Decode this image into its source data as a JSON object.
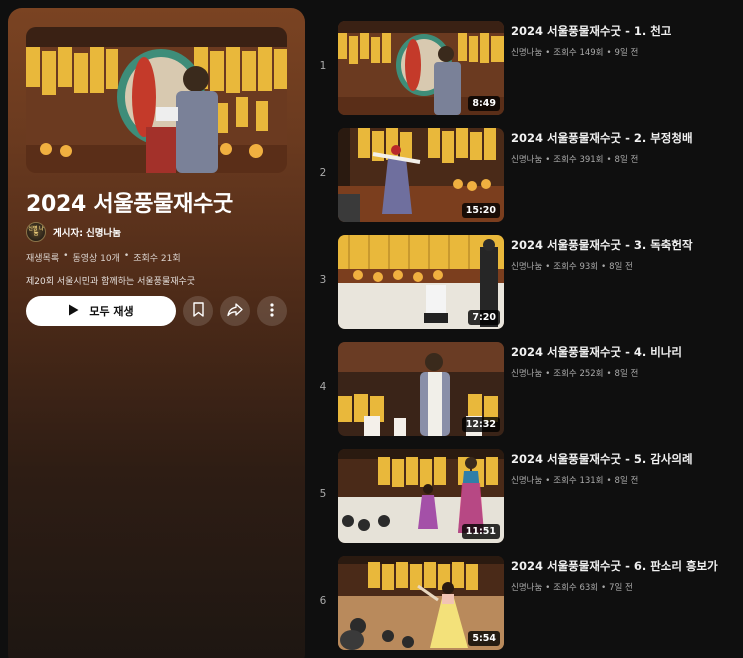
{
  "playlist": {
    "title": "2024 서울풍물재수굿",
    "owner_prefix": "게시자:",
    "owner_name": "신명나눔",
    "avatar_text": "신명\n나눔",
    "meta": {
      "type": "재생목록",
      "video_count": "동영상 10개",
      "views": "조회수 21회"
    },
    "description": "제20회 서울시민과 함께하는 서울풍물재수굿",
    "play_all_label": "모두 재생"
  },
  "videos": [
    {
      "index": "1",
      "title": "2024 서울풍물재수굿 - 1. 천고",
      "channel": "신명나눔",
      "views": "조회수 149회",
      "age": "9일 전",
      "duration": "8:49"
    },
    {
      "index": "2",
      "title": "2024 서울풍물재수굿 - 2. 부정청배",
      "channel": "신명나눔",
      "views": "조회수 391회",
      "age": "8일 전",
      "duration": "15:20"
    },
    {
      "index": "3",
      "title": "2024 서울풍물재수굿 - 3. 독축헌작",
      "channel": "신명나눔",
      "views": "조회수 93회",
      "age": "8일 전",
      "duration": "7:20"
    },
    {
      "index": "4",
      "title": "2024 서울풍물재수굿 - 4. 비나리",
      "channel": "신명나눔",
      "views": "조회수 252회",
      "age": "8일 전",
      "duration": "12:32"
    },
    {
      "index": "5",
      "title": "2024 서울풍물재수굿 - 5. 감사의례",
      "channel": "신명나눔",
      "views": "조회수 131회",
      "age": "8일 전",
      "duration": "11:51"
    },
    {
      "index": "6",
      "title": "2024 서울풍물재수굿 - 6. 판소리 흥보가",
      "channel": "신명나눔",
      "views": "조회수 63회",
      "age": "7일 전",
      "duration": "5:54"
    }
  ],
  "icons": {
    "play": "play-icon",
    "save": "bookmark-icon",
    "share": "share-icon",
    "more": "more-vert-icon"
  },
  "colors": {
    "panel_top": "#7a4322",
    "background": "#0f0f0f",
    "banner_yellow": "#e8b73a"
  }
}
